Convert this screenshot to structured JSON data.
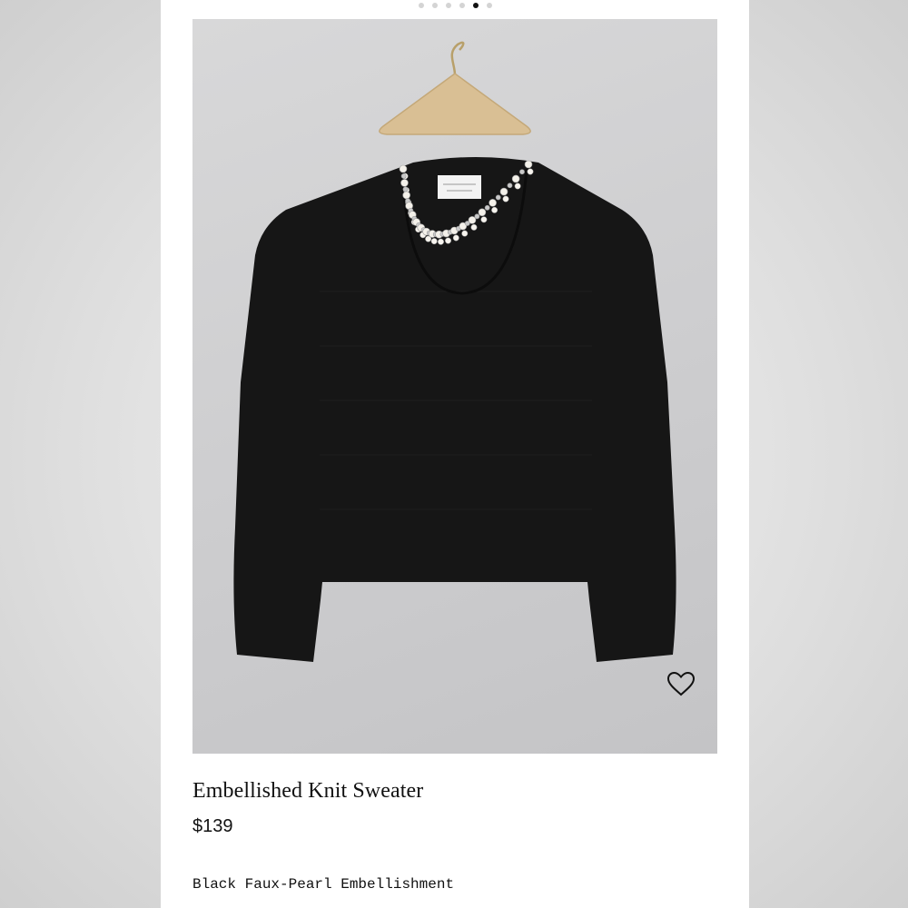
{
  "carousel": {
    "total": 6,
    "active_index": 4
  },
  "product": {
    "title": "Embellished Knit Sweater",
    "price": "$139",
    "color_label": "Black Faux-Pearl Embellishment",
    "image_icon": "sweater-on-hanger",
    "favorite_icon": "heart-outline-icon"
  },
  "colors": {
    "background": "#ffffff",
    "photo_backdrop": "#cfcfd1",
    "sweater": "#161616",
    "text": "#111111"
  }
}
